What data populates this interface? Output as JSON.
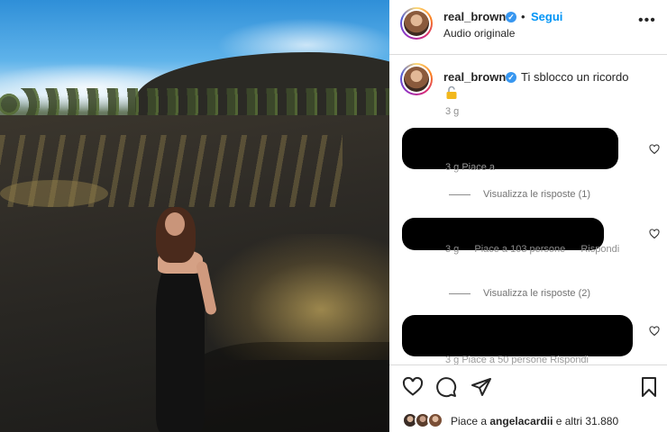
{
  "post": {
    "username": "real_brown",
    "follow_label": "Segui",
    "audio_label": "Audio originale",
    "more_label": "•••",
    "separator": "•"
  },
  "caption": {
    "username": "real_brown",
    "text": "Ti sblocco un ricordo",
    "time": "3 g"
  },
  "comments": [
    {
      "meta_time": "3 g",
      "meta_likes": "Piace a 103 persone",
      "meta_reply": "Rispondi",
      "view_replies": ""
    },
    {
      "meta_time": "3 g",
      "meta_likes": "Piace a 103 persone",
      "meta_reply": "Rispondi",
      "view_replies": ""
    }
  ],
  "comment1": {
    "partial_meta": "3 g   Piace a",
    "view_replies": "Visualizza le risposte (1)"
  },
  "comment2": {
    "time": "3 g",
    "likes": "Piace a 103 persone",
    "reply": "Rispondi",
    "view_replies": "Visualizza le risposte (2)"
  },
  "comment3": {
    "partial_meta": "3 g   Piace a 50 persone    Rispondi"
  },
  "likes_row": {
    "prefix": "Piace a",
    "user": "angelacardii",
    "suffix": "e altri 31.880"
  },
  "icons": {
    "verified": "verified-badge-icon",
    "more": "more-options-icon",
    "heart": "heart-icon",
    "comment": "comment-icon",
    "share": "share-icon",
    "save": "bookmark-icon",
    "lock": "unlocked-lock-emoji"
  },
  "colors": {
    "accent": "#0095f6",
    "verified": "#3897f0",
    "muted": "#8e8e8e"
  }
}
